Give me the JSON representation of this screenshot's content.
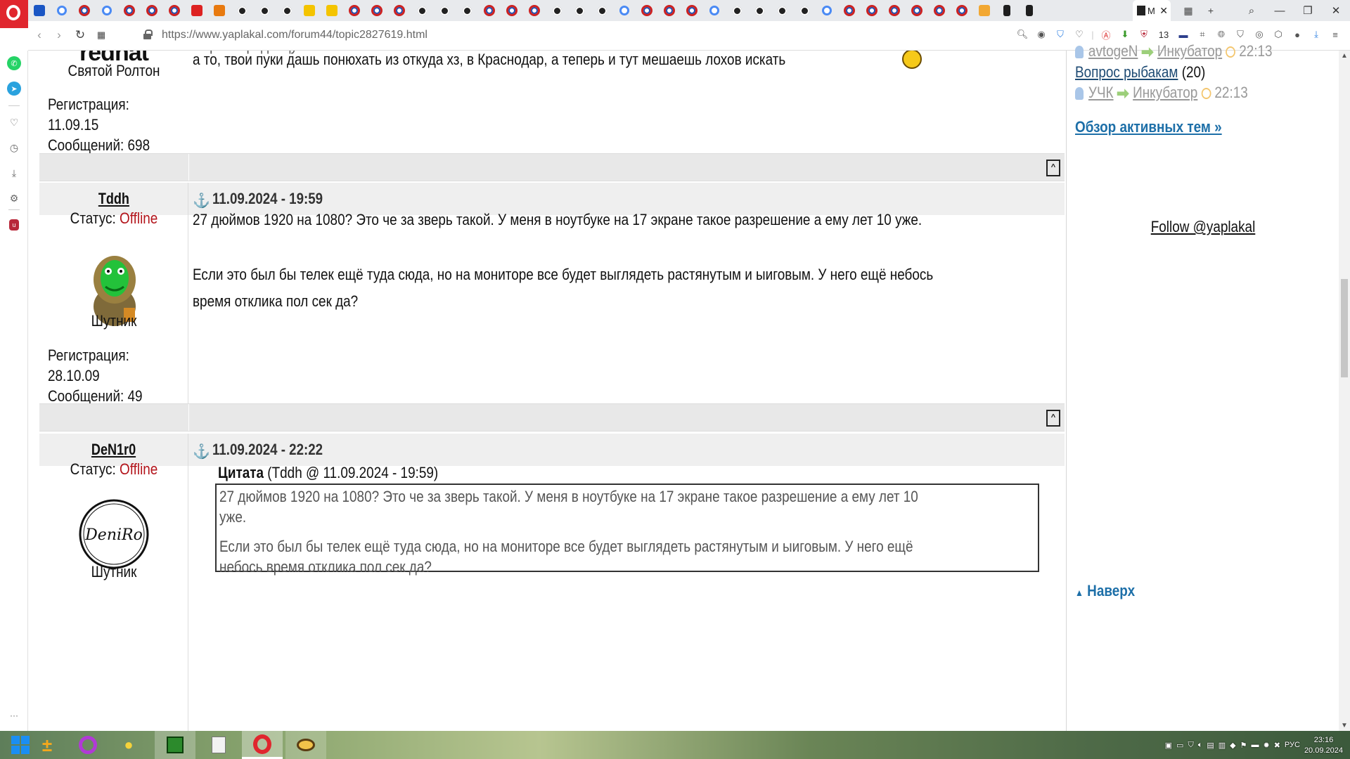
{
  "browser": {
    "url": "https://www.yaplakal.com/forum44/topic2827619.html",
    "active_tab_label": "М",
    "tab_close": "✕",
    "extension_count": "13",
    "new_tab": "+",
    "tab_grid": "▦",
    "search": "⌕",
    "window_minimize": "—",
    "window_restore": "❐",
    "window_close": "✕"
  },
  "sidebar": {
    "more": "···"
  },
  "posts": [
    {
      "partial_top_text": "Наро .. продавцу  кажт  нелоте",
      "rank": "Святой Ролтон",
      "text": "а то, твои пуки дашь понюхать из откуда хз, в Краснодар, а теперь и тут мешаешь лохов искать",
      "reg_label": "Регистрация:",
      "reg_date": "11.09.15",
      "msgs_label": "Сообщений: 698",
      "avatar_text": "redhat"
    },
    {
      "author": "Tddh",
      "date": "11.09.2024 - 19:59",
      "status_label": "Статус:",
      "status_value": "Offline",
      "rank": "Шутник",
      "para1": "27 дюймов 1920 на 1080? Это че за зверь такой. У меня в ноутбуке на 17 экране такое разрешение а ему лет 10 уже.",
      "para2_line1": "Если это был бы телек ещё туда сюда, но на мониторе все будет выглядеть растянутым и ыиговым. У него ещё небось",
      "para2_line2": "время отклика пол сек да?",
      "reg_label": "Регистрация:",
      "reg_date": "28.10.09",
      "msgs_label": "Сообщений: 49"
    },
    {
      "author": "DeN1r0",
      "date": "11.09.2024 - 22:22",
      "status_label": "Статус:",
      "status_value": "Offline",
      "rank": "Шутник",
      "avatar_text": "DeniRo",
      "quote_label": "Цитата",
      "quote_meta": "(Tddh @ 11.09.2024 - 19:59)",
      "quote_line1": "27 дюймов 1920 на 1080? Это че за зверь такой. У меня в ноутбуке на 17 экране такое разрешение а ему лет 10",
      "quote_line2": "уже.",
      "quote_line3": "Если это был бы телек ещё туда сюда, но на мониторе все будет выглядеть растянутым и ыиговым. У него ещё",
      "quote_line4": "небось время отклика пол сек да?"
    }
  ],
  "to_top_marker": "^",
  "right_panel": {
    "row1": {
      "user": "avtogeN",
      "forum": "Инкубатор",
      "time": "22:13"
    },
    "topic2": {
      "title": "Вопрос рыбакам",
      "count": "(20)"
    },
    "row2": {
      "user": "УЧК",
      "forum": "Инкубатор",
      "time": "22:13"
    },
    "overview_link": "Обзор активных тем »",
    "follow": "Follow @yaplakal",
    "back_to_top": "Наверх"
  },
  "taskbar": {
    "lang": "РУС",
    "time": "23:16",
    "date": "20.09.2024"
  }
}
